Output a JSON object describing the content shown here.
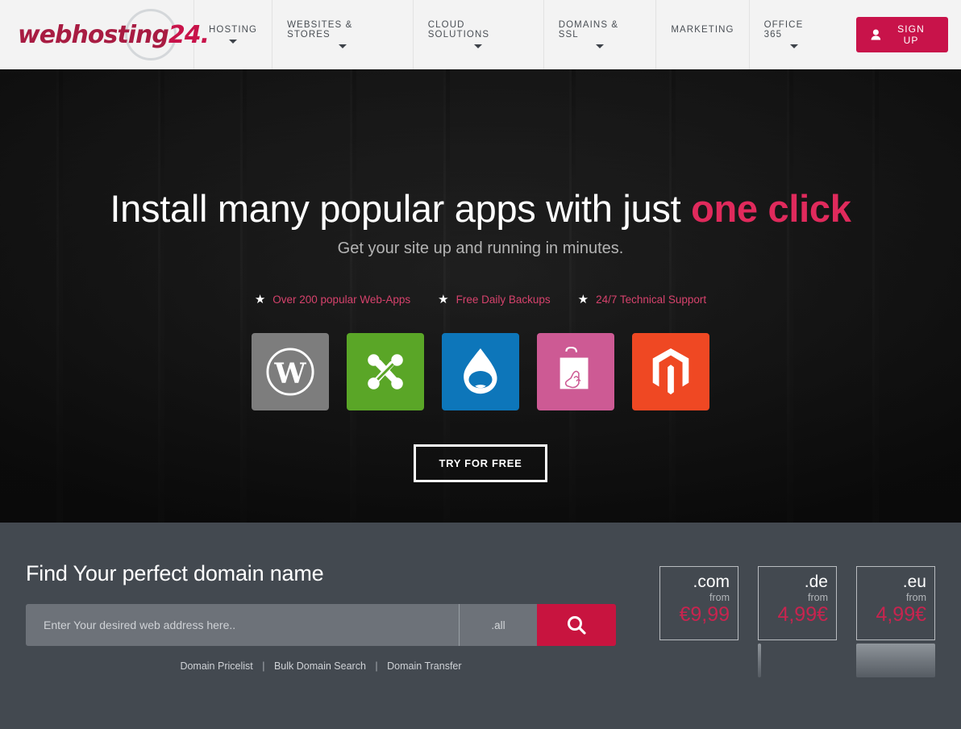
{
  "brand": {
    "logo_primary": "webhosting",
    "logo_secondary": "24",
    "logo_dot": ".",
    "accent_color": "#c8134a",
    "ring_color": "#d4d7da"
  },
  "header": {
    "nav_items": [
      {
        "label": "HOSTING",
        "has_caret": true
      },
      {
        "label": "WEBSITES & STORES",
        "has_caret": true
      },
      {
        "label": "CLOUD SOLUTIONS",
        "has_caret": true
      },
      {
        "label": "DOMAINS & SSL",
        "has_caret": true
      },
      {
        "label": "MARKETING",
        "has_caret": false
      },
      {
        "label": "OFFICE 365",
        "has_caret": true
      }
    ],
    "signup_label": "SIGN UP",
    "signup_icon": "user-icon"
  },
  "hero": {
    "title_main": "Install many popular apps with just ",
    "title_accent": "one click",
    "subtitle": "Get your site up and running in minutes.",
    "features": [
      {
        "icon": "star-icon",
        "label": "Over 200 popular Web-Apps"
      },
      {
        "icon": "star-icon",
        "label": "Free Daily Backups"
      },
      {
        "icon": "star-icon",
        "label": "24/7 Technical Support"
      }
    ],
    "apps": [
      {
        "name": "wordpress",
        "icon": "wordpress-icon",
        "color": "#7d7d7d"
      },
      {
        "name": "joomla",
        "icon": "joomla-icon",
        "color": "#5aa627"
      },
      {
        "name": "drupal",
        "icon": "drupal-icon",
        "color": "#0d76ba"
      },
      {
        "name": "prestashop",
        "icon": "prestashop-icon",
        "color": "#cd5a94"
      },
      {
        "name": "magento",
        "icon": "magento-icon",
        "color": "#ef4823"
      }
    ],
    "cta_label": "TRY FOR FREE"
  },
  "domain": {
    "title": "Find Your perfect domain name",
    "search_placeholder": "Enter Your desired web address here..",
    "search_value": "",
    "tld_selected": ".all",
    "search_icon": "search-icon",
    "links": [
      {
        "label": "Domain Pricelist"
      },
      {
        "label": "Bulk Domain Search"
      },
      {
        "label": "Domain Transfer"
      }
    ],
    "link_separator": "|",
    "price_cards": [
      {
        "tld": ".com",
        "from_label": "from",
        "price": "€9,99"
      },
      {
        "tld": ".de",
        "from_label": "from",
        "price": "4,99€"
      },
      {
        "tld": ".eu",
        "from_label": "from",
        "price": "4,99€"
      }
    ]
  }
}
